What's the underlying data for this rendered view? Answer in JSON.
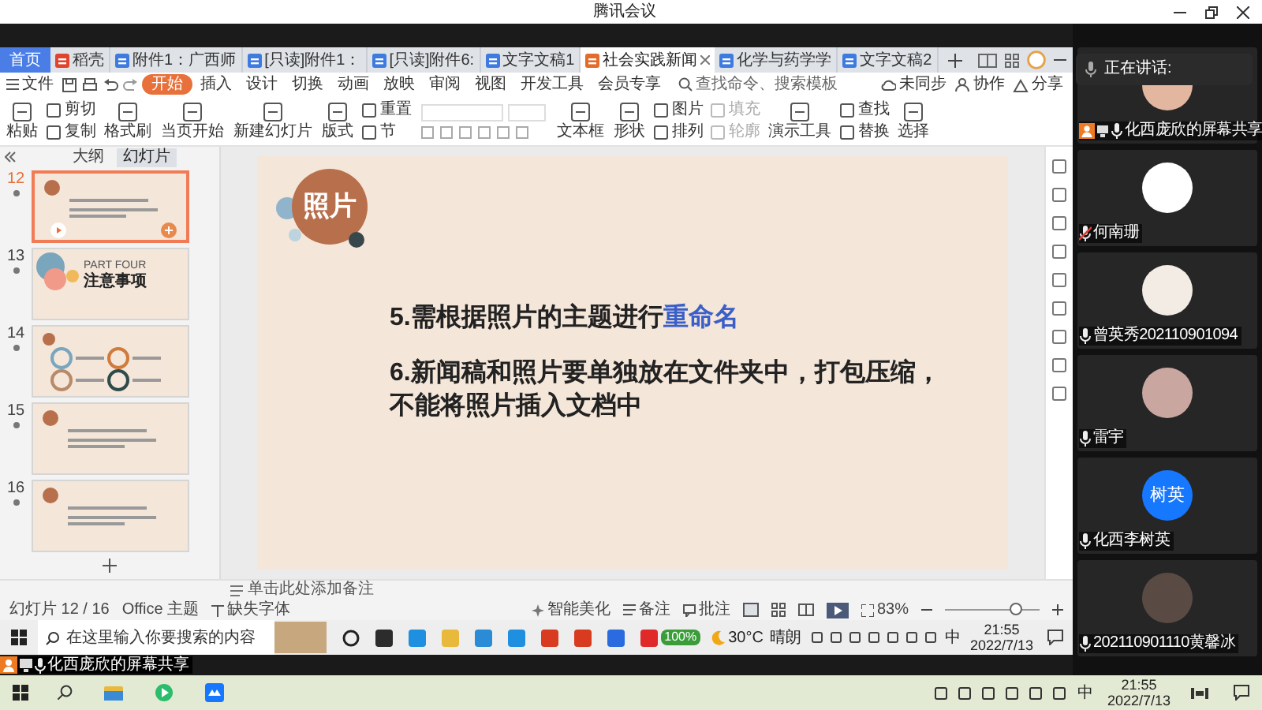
{
  "window": {
    "title": "腾讯会议"
  },
  "wps": {
    "tabs": [
      {
        "label": "首页",
        "kind": "home",
        "selected": false
      },
      {
        "label": "稻壳",
        "kind": "docer",
        "selected": false
      },
      {
        "label": "附件1：广西师",
        "kind": "doc",
        "selected": false
      },
      {
        "label": "[只读]附件1：",
        "kind": "doc",
        "selected": false
      },
      {
        "label": "[只读]附件6:",
        "kind": "doc",
        "selected": false
      },
      {
        "label": "文字文稿1",
        "kind": "doc",
        "selected": false
      },
      {
        "label": "社会实践新闻",
        "kind": "ppt",
        "selected": true
      },
      {
        "label": "化学与药学学",
        "kind": "doc",
        "selected": false
      },
      {
        "label": "文字文稿2",
        "kind": "doc",
        "selected": false
      }
    ],
    "file_menu": "文件",
    "menu_tabs": [
      {
        "label": "开始",
        "selected": true
      },
      {
        "label": "插入",
        "selected": false
      },
      {
        "label": "设计",
        "selected": false
      },
      {
        "label": "切换",
        "selected": false
      },
      {
        "label": "动画",
        "selected": false
      },
      {
        "label": "放映",
        "selected": false
      },
      {
        "label": "审阅",
        "selected": false
      },
      {
        "label": "视图",
        "selected": false
      },
      {
        "label": "开发工具",
        "selected": false
      },
      {
        "label": "会员专享",
        "selected": false
      }
    ],
    "search": {
      "placeholder": "查找命令、搜索模板"
    },
    "menu_actions": [
      "未同步",
      "协作",
      "分享"
    ],
    "ribbon": [
      {
        "kind": "large",
        "items": [
          {
            "label": "粘贴",
            "disabled": false
          }
        ]
      },
      {
        "kind": "stack",
        "items": [
          {
            "label": "剪切",
            "disabled": false
          },
          {
            "label": "复制",
            "disabled": false
          }
        ]
      },
      {
        "kind": "large",
        "items": [
          {
            "label": "格式刷",
            "disabled": false
          }
        ]
      },
      {
        "kind": "large",
        "items": [
          {
            "label": "当页开始",
            "disabled": false
          }
        ]
      },
      {
        "kind": "large",
        "items": [
          {
            "label": "新建幻灯片",
            "disabled": false
          }
        ]
      },
      {
        "kind": "large",
        "items": [
          {
            "label": "版式",
            "disabled": false
          }
        ]
      },
      {
        "kind": "stack",
        "items": [
          {
            "label": "重置",
            "disabled": false
          },
          {
            "label": "节",
            "disabled": false
          }
        ]
      },
      {
        "kind": "font"
      },
      {
        "kind": "large",
        "items": [
          {
            "label": "文本框",
            "disabled": false
          }
        ]
      },
      {
        "kind": "large",
        "items": [
          {
            "label": "形状",
            "disabled": false
          }
        ]
      },
      {
        "kind": "stack",
        "items": [
          {
            "label": "图片",
            "disabled": false
          },
          {
            "label": "排列",
            "disabled": false
          }
        ]
      },
      {
        "kind": "stack",
        "items": [
          {
            "label": "填充",
            "disabled": true
          },
          {
            "label": "轮廓",
            "disabled": true
          }
        ]
      },
      {
        "kind": "large",
        "items": [
          {
            "label": "演示工具",
            "disabled": false
          }
        ]
      },
      {
        "kind": "stack",
        "items": [
          {
            "label": "查找",
            "disabled": false
          },
          {
            "label": "替换",
            "disabled": false
          }
        ]
      },
      {
        "kind": "large",
        "items": [
          {
            "label": "选择",
            "disabled": false
          }
        ]
      }
    ],
    "panel_tabs": [
      {
        "label": "大纲",
        "selected": false
      },
      {
        "label": "幻灯片",
        "selected": true
      }
    ],
    "thumbnails": [
      {
        "number": "12",
        "kind": "text",
        "selected": true
      },
      {
        "number": "13",
        "kind": "section",
        "selected": false,
        "texts": [
          "PART FOUR",
          "注意事项"
        ]
      },
      {
        "number": "14",
        "kind": "diagram",
        "selected": false
      },
      {
        "number": "15",
        "kind": "text",
        "selected": false
      },
      {
        "number": "16",
        "kind": "text",
        "selected": false
      }
    ],
    "slide": {
      "title": "照片",
      "lines": [
        [
          {
            "text": "5.需根据照片的主题进行",
            "highlight": false
          },
          {
            "text": "重命名",
            "highlight": true
          }
        ],
        [
          {
            "text": "6.新闻稿和照片要单独放在文件夹中，打包压缩，不能将照片插入文档中",
            "highlight": false
          }
        ]
      ]
    },
    "notes_placeholder": "单击此处添加备注",
    "status_bar": {
      "slide": "幻灯片 12 / 16",
      "theme": "Office 主题",
      "missing_font": "缺失字体",
      "beautify": "智能美化",
      "notes": "备注",
      "comments": "批注",
      "zoom": "83%",
      "zoom_level": {
        "level": 0.75
      }
    }
  },
  "inner_taskbar": {
    "search": {
      "placeholder": "在这里输入你要搜索的内容"
    },
    "battery": "100%",
    "temperature": "30°C",
    "weather": "晴朗",
    "ime": "中",
    "time": "21:55",
    "date": "2022/7/13"
  },
  "share_bar": {
    "label": "化西庞欣的屏幕共享"
  },
  "speaking": {
    "label": "正在讲话:"
  },
  "participants": [
    {
      "name": "化西庞欣的屏幕共享",
      "muted": false,
      "sharing": true,
      "kind": "photo"
    },
    {
      "name": "何南珊",
      "muted": true,
      "sharing": false,
      "kind": "photo"
    },
    {
      "name": "曾英秀202110901094",
      "muted": false,
      "sharing": false,
      "kind": "photo"
    },
    {
      "name": "雷宇",
      "muted": false,
      "sharing": false,
      "kind": "photo"
    },
    {
      "name": "化西李树英",
      "muted": false,
      "sharing": false,
      "kind": "initials",
      "initials": "树英"
    },
    {
      "name": "202110901110黄馨冰",
      "muted": false,
      "sharing": false,
      "kind": "photo"
    }
  ],
  "taskbar": {
    "ime": "中",
    "time": "21:55",
    "date": "2022/7/13"
  }
}
